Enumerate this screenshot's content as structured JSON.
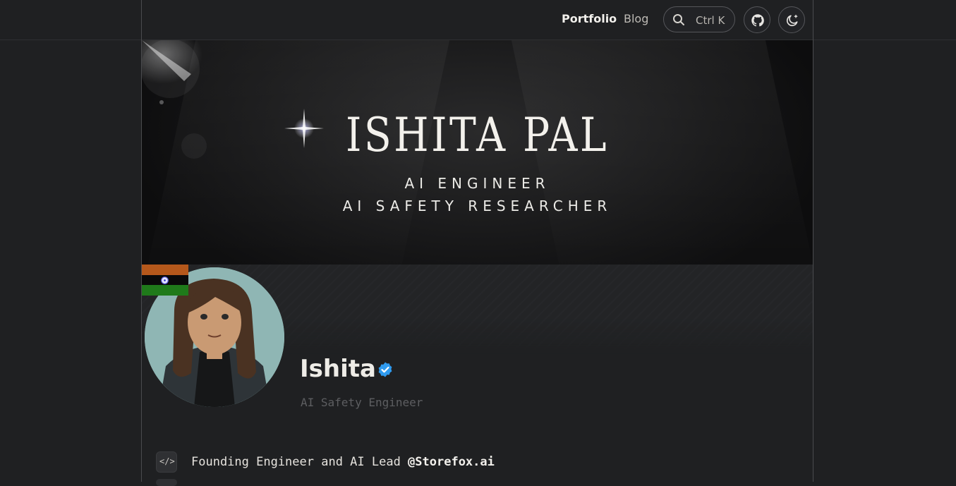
{
  "nav": {
    "portfolio": "Portfolio",
    "blog": "Blog",
    "search_shortcut": "Ctrl K",
    "github_icon": "github-icon",
    "theme_icon": "theme-toggle-icon"
  },
  "banner": {
    "title": "ISHITA PAL",
    "subtitle1": "AI ENGINEER",
    "subtitle2": "AI SAFETY RESEARCHER"
  },
  "profile": {
    "name": "Ishita",
    "tagline": "AI Safety Engineer",
    "flag_colors": [
      "#b5581b",
      "#0a0a0a",
      "#1f7a1a"
    ],
    "verified_color": "#2f9bf0"
  },
  "info": {
    "row1_prefix": "Founding Engineer and AI Lead ",
    "row1_highlight": "@Storefox.ai",
    "row1_icon": "code-icon"
  }
}
